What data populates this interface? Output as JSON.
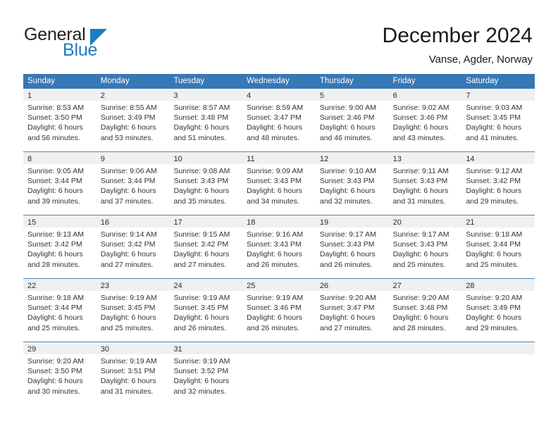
{
  "brand": {
    "name_top": "General",
    "name_bottom": "Blue",
    "triangle_icon": "triangle-icon",
    "accent_color": "#1a7dc4",
    "text_color": "#231f20"
  },
  "header": {
    "title": "December 2024",
    "subtitle": "Vanse, Agder, Norway",
    "header_bg_color": "#3778b5",
    "header_text_color": "#ffffff",
    "day_band_color": "#f0f0f0"
  },
  "weekdays": [
    "Sunday",
    "Monday",
    "Tuesday",
    "Wednesday",
    "Thursday",
    "Friday",
    "Saturday"
  ],
  "weeks": [
    [
      {
        "day": "1",
        "lines": [
          "Sunrise: 8:53 AM",
          "Sunset: 3:50 PM",
          "Daylight: 6 hours",
          "and 56 minutes."
        ]
      },
      {
        "day": "2",
        "lines": [
          "Sunrise: 8:55 AM",
          "Sunset: 3:49 PM",
          "Daylight: 6 hours",
          "and 53 minutes."
        ]
      },
      {
        "day": "3",
        "lines": [
          "Sunrise: 8:57 AM",
          "Sunset: 3:48 PM",
          "Daylight: 6 hours",
          "and 51 minutes."
        ]
      },
      {
        "day": "4",
        "lines": [
          "Sunrise: 8:59 AM",
          "Sunset: 3:47 PM",
          "Daylight: 6 hours",
          "and 48 minutes."
        ]
      },
      {
        "day": "5",
        "lines": [
          "Sunrise: 9:00 AM",
          "Sunset: 3:46 PM",
          "Daylight: 6 hours",
          "and 46 minutes."
        ]
      },
      {
        "day": "6",
        "lines": [
          "Sunrise: 9:02 AM",
          "Sunset: 3:46 PM",
          "Daylight: 6 hours",
          "and 43 minutes."
        ]
      },
      {
        "day": "7",
        "lines": [
          "Sunrise: 9:03 AM",
          "Sunset: 3:45 PM",
          "Daylight: 6 hours",
          "and 41 minutes."
        ]
      }
    ],
    [
      {
        "day": "8",
        "lines": [
          "Sunrise: 9:05 AM",
          "Sunset: 3:44 PM",
          "Daylight: 6 hours",
          "and 39 minutes."
        ]
      },
      {
        "day": "9",
        "lines": [
          "Sunrise: 9:06 AM",
          "Sunset: 3:44 PM",
          "Daylight: 6 hours",
          "and 37 minutes."
        ]
      },
      {
        "day": "10",
        "lines": [
          "Sunrise: 9:08 AM",
          "Sunset: 3:43 PM",
          "Daylight: 6 hours",
          "and 35 minutes."
        ]
      },
      {
        "day": "11",
        "lines": [
          "Sunrise: 9:09 AM",
          "Sunset: 3:43 PM",
          "Daylight: 6 hours",
          "and 34 minutes."
        ]
      },
      {
        "day": "12",
        "lines": [
          "Sunrise: 9:10 AM",
          "Sunset: 3:43 PM",
          "Daylight: 6 hours",
          "and 32 minutes."
        ]
      },
      {
        "day": "13",
        "lines": [
          "Sunrise: 9:11 AM",
          "Sunset: 3:43 PM",
          "Daylight: 6 hours",
          "and 31 minutes."
        ]
      },
      {
        "day": "14",
        "lines": [
          "Sunrise: 9:12 AM",
          "Sunset: 3:42 PM",
          "Daylight: 6 hours",
          "and 29 minutes."
        ]
      }
    ],
    [
      {
        "day": "15",
        "lines": [
          "Sunrise: 9:13 AM",
          "Sunset: 3:42 PM",
          "Daylight: 6 hours",
          "and 28 minutes."
        ]
      },
      {
        "day": "16",
        "lines": [
          "Sunrise: 9:14 AM",
          "Sunset: 3:42 PM",
          "Daylight: 6 hours",
          "and 27 minutes."
        ]
      },
      {
        "day": "17",
        "lines": [
          "Sunrise: 9:15 AM",
          "Sunset: 3:42 PM",
          "Daylight: 6 hours",
          "and 27 minutes."
        ]
      },
      {
        "day": "18",
        "lines": [
          "Sunrise: 9:16 AM",
          "Sunset: 3:43 PM",
          "Daylight: 6 hours",
          "and 26 minutes."
        ]
      },
      {
        "day": "19",
        "lines": [
          "Sunrise: 9:17 AM",
          "Sunset: 3:43 PM",
          "Daylight: 6 hours",
          "and 26 minutes."
        ]
      },
      {
        "day": "20",
        "lines": [
          "Sunrise: 9:17 AM",
          "Sunset: 3:43 PM",
          "Daylight: 6 hours",
          "and 25 minutes."
        ]
      },
      {
        "day": "21",
        "lines": [
          "Sunrise: 9:18 AM",
          "Sunset: 3:44 PM",
          "Daylight: 6 hours",
          "and 25 minutes."
        ]
      }
    ],
    [
      {
        "day": "22",
        "lines": [
          "Sunrise: 9:18 AM",
          "Sunset: 3:44 PM",
          "Daylight: 6 hours",
          "and 25 minutes."
        ]
      },
      {
        "day": "23",
        "lines": [
          "Sunrise: 9:19 AM",
          "Sunset: 3:45 PM",
          "Daylight: 6 hours",
          "and 25 minutes."
        ]
      },
      {
        "day": "24",
        "lines": [
          "Sunrise: 9:19 AM",
          "Sunset: 3:45 PM",
          "Daylight: 6 hours",
          "and 26 minutes."
        ]
      },
      {
        "day": "25",
        "lines": [
          "Sunrise: 9:19 AM",
          "Sunset: 3:46 PM",
          "Daylight: 6 hours",
          "and 26 minutes."
        ]
      },
      {
        "day": "26",
        "lines": [
          "Sunrise: 9:20 AM",
          "Sunset: 3:47 PM",
          "Daylight: 6 hours",
          "and 27 minutes."
        ]
      },
      {
        "day": "27",
        "lines": [
          "Sunrise: 9:20 AM",
          "Sunset: 3:48 PM",
          "Daylight: 6 hours",
          "and 28 minutes."
        ]
      },
      {
        "day": "28",
        "lines": [
          "Sunrise: 9:20 AM",
          "Sunset: 3:49 PM",
          "Daylight: 6 hours",
          "and 29 minutes."
        ]
      }
    ],
    [
      {
        "day": "29",
        "lines": [
          "Sunrise: 9:20 AM",
          "Sunset: 3:50 PM",
          "Daylight: 6 hours",
          "and 30 minutes."
        ]
      },
      {
        "day": "30",
        "lines": [
          "Sunrise: 9:19 AM",
          "Sunset: 3:51 PM",
          "Daylight: 6 hours",
          "and 31 minutes."
        ]
      },
      {
        "day": "31",
        "lines": [
          "Sunrise: 9:19 AM",
          "Sunset: 3:52 PM",
          "Daylight: 6 hours",
          "and 32 minutes."
        ]
      },
      {
        "day": "",
        "lines": []
      },
      {
        "day": "",
        "lines": []
      },
      {
        "day": "",
        "lines": []
      },
      {
        "day": "",
        "lines": []
      }
    ]
  ]
}
